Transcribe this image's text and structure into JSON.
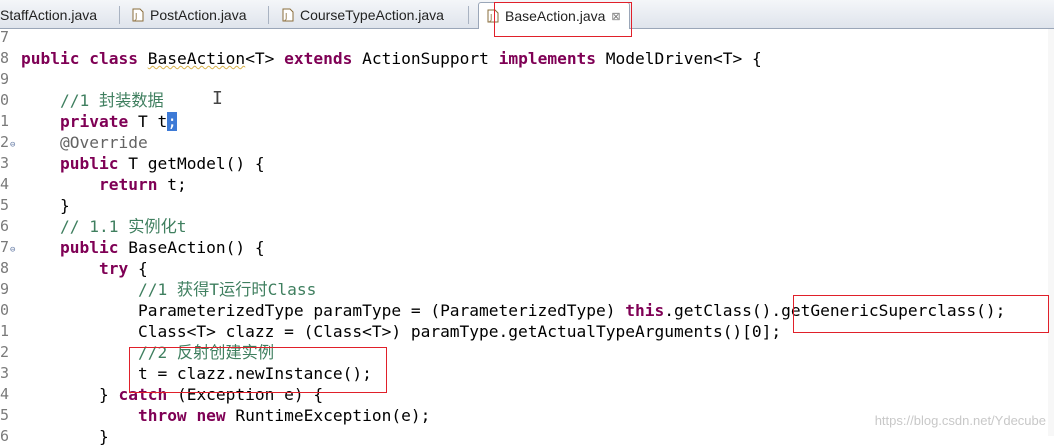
{
  "tabs": [
    {
      "label": "StaffAction.java"
    },
    {
      "label": "PostAction.java"
    },
    {
      "label": "CourseTypeAction.java"
    },
    {
      "label": "BaseAction.java",
      "close": "⊠"
    }
  ],
  "colors": {
    "keyword": "#7f0055",
    "comment": "#3f7f5f",
    "annotation": "#646464",
    "highlight_box": "#e0202a",
    "selection": "#3d7ad6"
  },
  "editor": {
    "lines": [
      {
        "num": "7",
        "tokens": []
      },
      {
        "num": "8",
        "tokens": [
          {
            "t": "public",
            "c": "kw"
          },
          {
            "t": " "
          },
          {
            "t": "class",
            "c": "kw"
          },
          {
            "t": " "
          },
          {
            "t": "BaseAction",
            "c": "sq"
          },
          {
            "t": "<T> "
          },
          {
            "t": "extends",
            "c": "kw"
          },
          {
            "t": " ActionSupport "
          },
          {
            "t": "implements",
            "c": "kw"
          },
          {
            "t": " ModelDriven<T> {"
          }
        ]
      },
      {
        "num": "9",
        "tokens": []
      },
      {
        "num": "0",
        "tokens": [
          {
            "t": "    "
          },
          {
            "t": "//1 封装数据",
            "c": "cm"
          }
        ]
      },
      {
        "num": "1",
        "tokens": [
          {
            "t": "    "
          },
          {
            "t": "private",
            "c": "kw"
          },
          {
            "t": " T t"
          },
          {
            "t": ";",
            "c": "sel"
          }
        ]
      },
      {
        "num": "2",
        "fold": "⊖",
        "tokens": [
          {
            "t": "    "
          },
          {
            "t": "@Override",
            "c": "an"
          }
        ]
      },
      {
        "num": "3",
        "tokens": [
          {
            "t": "    "
          },
          {
            "t": "public",
            "c": "kw"
          },
          {
            "t": " T getModel() {"
          }
        ]
      },
      {
        "num": "4",
        "tokens": [
          {
            "t": "        "
          },
          {
            "t": "return",
            "c": "kw"
          },
          {
            "t": " t;"
          }
        ]
      },
      {
        "num": "5",
        "tokens": [
          {
            "t": "    }"
          }
        ]
      },
      {
        "num": "6",
        "tokens": [
          {
            "t": "    "
          },
          {
            "t": "// 1.1 实例化t",
            "c": "cm"
          }
        ]
      },
      {
        "num": "7",
        "fold": "⊖",
        "tokens": [
          {
            "t": "    "
          },
          {
            "t": "public",
            "c": "kw"
          },
          {
            "t": " BaseAction() {"
          }
        ]
      },
      {
        "num": "8",
        "tokens": [
          {
            "t": "        "
          },
          {
            "t": "try",
            "c": "kw"
          },
          {
            "t": " {"
          }
        ]
      },
      {
        "num": "9",
        "tokens": [
          {
            "t": "            "
          },
          {
            "t": "//1 获得T运行时Class",
            "c": "cm"
          }
        ]
      },
      {
        "num": "0",
        "tokens": [
          {
            "t": "            ParameterizedType paramType = (ParameterizedType) "
          },
          {
            "t": "this",
            "c": "kw"
          },
          {
            "t": ".getClass().getGenericSuperclass();"
          }
        ]
      },
      {
        "num": "1",
        "tokens": [
          {
            "t": "            Class<T> clazz = (Class<T>) paramType.getActualTypeArguments()[0];"
          }
        ]
      },
      {
        "num": "2",
        "tokens": [
          {
            "t": "            "
          },
          {
            "t": "//2 反射创建实例",
            "c": "cm"
          }
        ]
      },
      {
        "num": "3",
        "tokens": [
          {
            "t": "            t = clazz.newInstance();"
          }
        ]
      },
      {
        "num": "4",
        "tokens": [
          {
            "t": "        } "
          },
          {
            "t": "catch",
            "c": "kw"
          },
          {
            "t": " (Exception e) {"
          }
        ]
      },
      {
        "num": "5",
        "tokens": [
          {
            "t": "            "
          },
          {
            "t": "throw",
            "c": "kw"
          },
          {
            "t": " "
          },
          {
            "t": "new",
            "c": "kw"
          },
          {
            "t": " RuntimeException(e);"
          }
        ]
      },
      {
        "num": "6",
        "tokens": [
          {
            "t": "        }"
          }
        ]
      }
    ]
  },
  "watermark": "https://blog.csdn.net/Ydecube"
}
